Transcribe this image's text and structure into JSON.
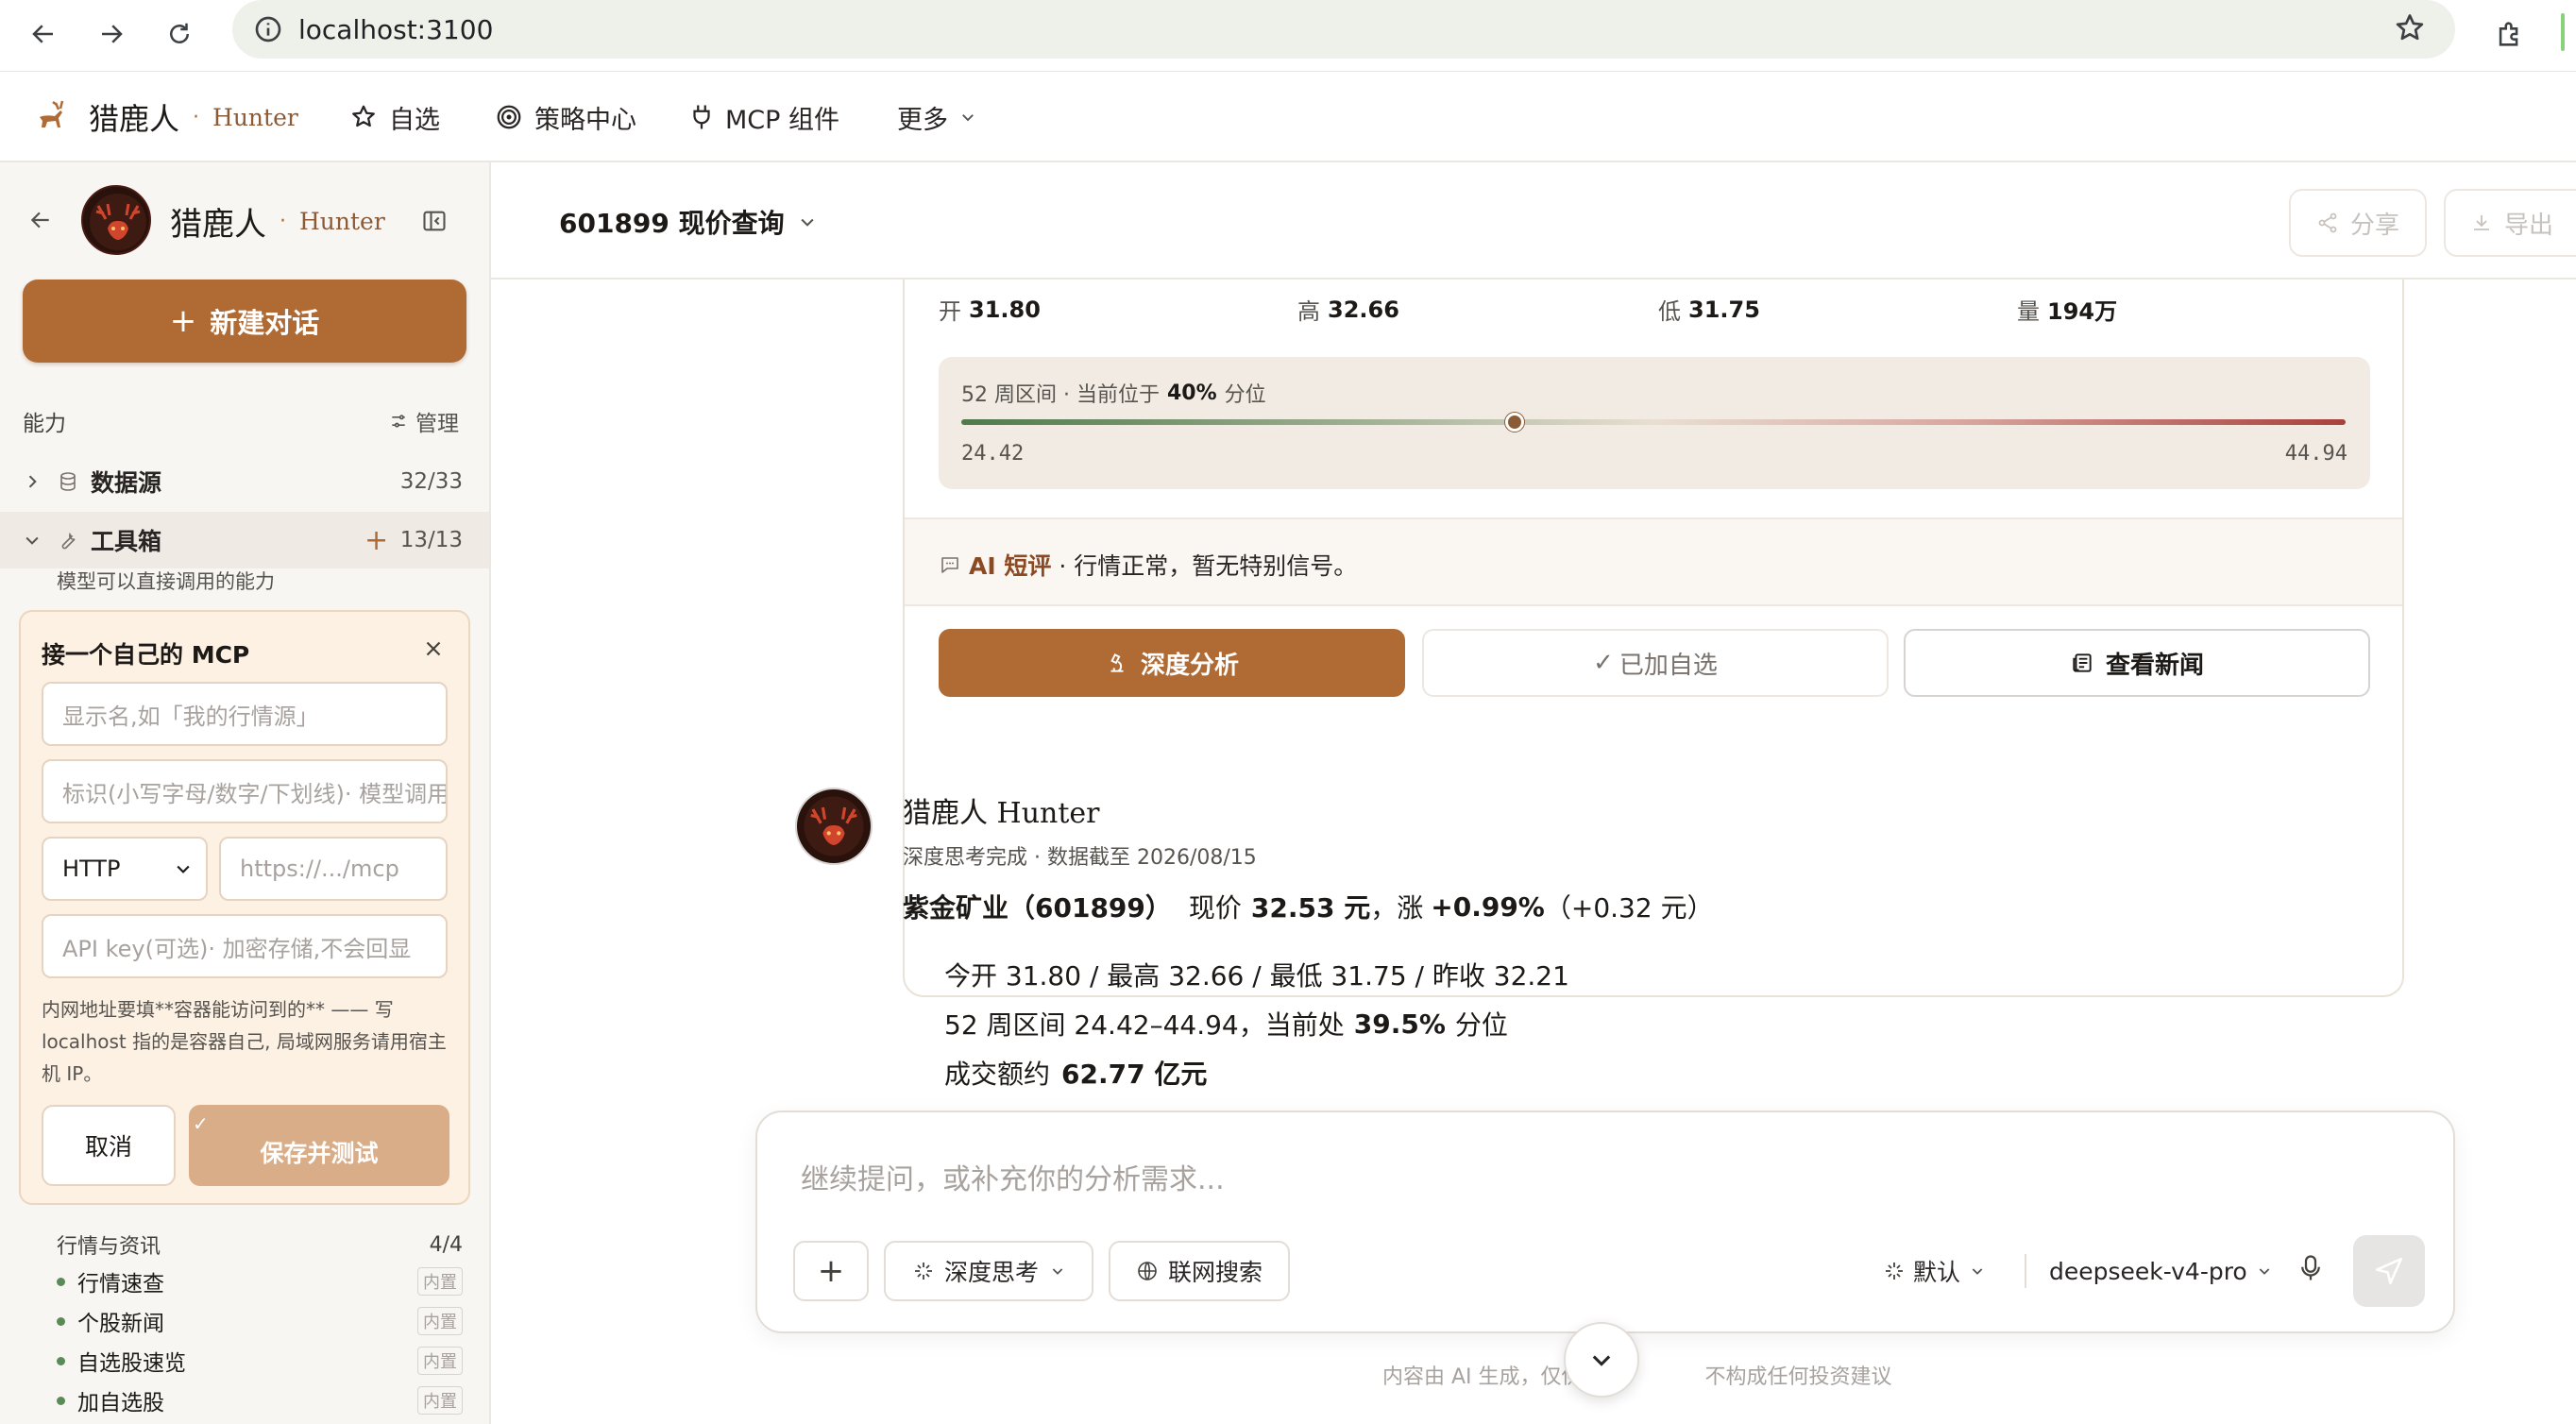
{
  "browser": {
    "url": "localhost:3100"
  },
  "app": {
    "brand": "猎鹿人",
    "brand_en": "Hunter",
    "nav": [
      {
        "label": "自选",
        "icon": "star-icon"
      },
      {
        "label": "策略中心",
        "icon": "target-icon"
      },
      {
        "label": "MCP 组件",
        "icon": "plug-icon"
      },
      {
        "label": "更多",
        "icon": "chevron-down-icon"
      }
    ]
  },
  "sidebar": {
    "brand": "猎鹿人",
    "brand_en": "Hunter",
    "new_chat": "新建对话",
    "section_label": "能力",
    "manage_label": "管理",
    "datasource": {
      "label": "数据源",
      "count": "32/33"
    },
    "toolbox": {
      "label": "工具箱",
      "count": "13/13",
      "desc": "模型可以直接调用的能力"
    },
    "mcp_form": {
      "title": "接一个自己的 MCP",
      "name_placeholder": "显示名,如「我的行情源」",
      "id_placeholder": "标识(小写字母/数字/下划线)· 模型调用",
      "protocol": "HTTP",
      "url_placeholder": "https://.../mcp",
      "apikey_placeholder": "API key(可选)· 加密存储,不会回显",
      "hint": "内网地址要填**容器能访问到的** —— 写 localhost 指的是容器自己, 局域网服务请用宿主机 IP。",
      "cancel": "取消",
      "save": "保存并测试"
    },
    "group": {
      "label": "行情与资讯",
      "count": "4/4"
    },
    "tools": [
      {
        "label": "行情速查",
        "badge": "内置"
      },
      {
        "label": "个股新闻",
        "badge": "内置"
      },
      {
        "label": "自选股速览",
        "badge": "内置"
      },
      {
        "label": "加自选股",
        "badge": "内置"
      }
    ]
  },
  "conversation": {
    "title": "601899 现价查询",
    "share": "分享",
    "export": "导出"
  },
  "quote_card": {
    "stats": [
      {
        "label": "开",
        "value": "31.80"
      },
      {
        "label": "高",
        "value": "32.66"
      },
      {
        "label": "低",
        "value": "31.75"
      },
      {
        "label": "量",
        "value": "194万"
      }
    ],
    "range_label_prefix": "52 周区间 · 当前位于",
    "range_pct": "40%",
    "range_label_suffix": "分位",
    "range_low": "24.42",
    "range_high": "44.94",
    "range_position": 0.4,
    "ai_label": "AI 短评",
    "ai_text": "· 行情正常，暂无特别信号。",
    "btn_analysis": "深度分析",
    "btn_added": "已加自选",
    "btn_news": "查看新闻"
  },
  "message": {
    "author": "猎鹿人 Hunter",
    "meta": "深度思考完成 · 数据截至 2026/08/15",
    "headline_stock": "紫金矿业（601899）",
    "headline_mid": "现价",
    "headline_price": "32.53 元",
    "headline_chg_prefix": "，涨",
    "headline_pct": "+0.99%",
    "headline_abs": "（+0.32 元）",
    "line1": "今开 31.80 / 最高 32.66 / 最低 31.75 / 昨收 32.21",
    "line2_prefix": "52 周区间 24.42–44.94，当前处",
    "line2_pct": "39.5%",
    "line2_suffix": "分位",
    "line3_prefix": "成交额约",
    "line3_value": "62.77 亿元"
  },
  "composer": {
    "placeholder": "继续提问，或补充你的分析需求...",
    "deep_think": "深度思考",
    "web_search": "联网搜索",
    "mode": "默认",
    "model": "deepseek-v4-pro",
    "disclaimer_left": "内容由 AI 生成，仅供",
    "disclaimer_right": "不构成任何投资建议"
  },
  "colors": {
    "accent": "#b06a34",
    "accent_light": "#d9ad88",
    "range_start": "#4f7a4a",
    "range_end": "#a8413b"
  }
}
